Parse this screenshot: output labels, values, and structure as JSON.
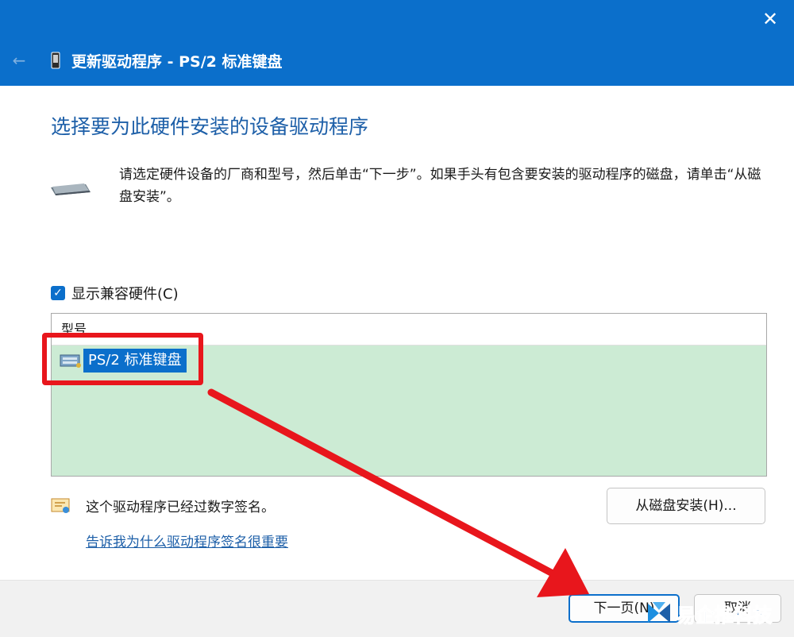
{
  "titlebar": {
    "title": "更新驱动程序 - PS/2 标准键盘",
    "close_glyph": "✕",
    "back_glyph": "←",
    "color": "#0b6fcb"
  },
  "main": {
    "heading": "选择要为此硬件安装的设备驱动程序",
    "instruction": "请选定硬件设备的厂商和型号，然后单击“下一步”。如果手头有包含要安装的驱动程序的磁盘，请单击“从磁盘安装”。",
    "show_compatible": {
      "label": "显示兼容硬件(C)",
      "checked": true
    },
    "model_list": {
      "header": "型号",
      "items": [
        {
          "label": "PS/2 标准键盘",
          "selected": true
        }
      ]
    },
    "signed_text": "这个驱动程序已经过数字签名。",
    "why_link": "告诉我为什么驱动程序签名很重要",
    "disk_button": "从磁盘安装(H)..."
  },
  "footer": {
    "next_button": "下一页(N)",
    "cancel_button": "取消"
  },
  "watermark": {
    "text": "易企推科技"
  },
  "annotation_color": "#e8161c"
}
